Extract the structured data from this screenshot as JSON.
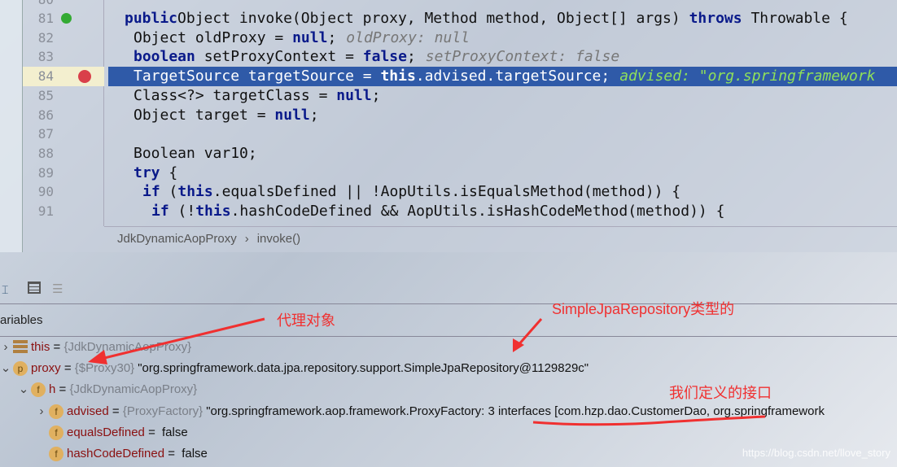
{
  "editor": {
    "lines": [
      {
        "n": "81",
        "indent": 1,
        "parts": [
          [
            "kw",
            "public"
          ],
          [
            "",
            "Object invoke(Object proxy, Method method, Object[] args) "
          ],
          [
            "kw",
            "throws"
          ],
          [
            "",
            " Throwable {"
          ]
        ]
      },
      {
        "n": "82",
        "indent": 2,
        "parts": [
          [
            "",
            "Object oldProxy = "
          ],
          [
            "kw",
            "null"
          ],
          [
            "",
            ";"
          ],
          [
            "hint",
            "oldProxy: null"
          ]
        ]
      },
      {
        "n": "83",
        "indent": 2,
        "parts": [
          [
            "kw",
            "boolean"
          ],
          [
            "",
            " setProxyContext = "
          ],
          [
            "kw",
            "false"
          ],
          [
            "",
            ";"
          ],
          [
            "hint",
            "setProxyContext: false"
          ]
        ]
      },
      {
        "n": "84",
        "indent": 2,
        "current": true,
        "parts": [
          [
            "",
            "TargetSource targetSource = "
          ],
          [
            "kw",
            "this"
          ],
          [
            "",
            ".advised.targetSource;"
          ],
          [
            "hint",
            "advised: \"org.springframework"
          ]
        ]
      },
      {
        "n": "85",
        "indent": 2,
        "parts": [
          [
            "",
            "Class<?> targetClass = "
          ],
          [
            "kw",
            "null"
          ],
          [
            "",
            ";"
          ]
        ]
      },
      {
        "n": "86",
        "indent": 2,
        "parts": [
          [
            "",
            "Object target = "
          ],
          [
            "kw",
            "null"
          ],
          [
            "",
            ";"
          ]
        ]
      },
      {
        "n": "87",
        "indent": 0,
        "parts": []
      },
      {
        "n": "88",
        "indent": 2,
        "parts": [
          [
            "",
            "Boolean var10;"
          ]
        ]
      },
      {
        "n": "89",
        "indent": 2,
        "parts": [
          [
            "kw",
            "try"
          ],
          [
            "",
            " {"
          ]
        ]
      },
      {
        "n": "90",
        "indent": 3,
        "parts": [
          [
            "kw",
            "if"
          ],
          [
            "",
            " ("
          ],
          [
            "kw",
            "this"
          ],
          [
            "",
            ".equalsDefined || !AopUtils.isEqualsMethod(method)) {"
          ]
        ]
      },
      {
        "n": "91",
        "indent": 4,
        "parts": [
          [
            "kw",
            "if"
          ],
          [
            "",
            " (!"
          ],
          [
            "kw",
            "this"
          ],
          [
            "",
            ".hashCodeDefined && AopUtils.isHashCodeMethod(method)) {"
          ]
        ]
      }
    ],
    "breadcrumb": [
      "JdkDynamicAopProxy",
      "invoke()"
    ]
  },
  "variables": {
    "header": "ariables",
    "rows": [
      {
        "icon": "field-list-icon",
        "letter": "",
        "name": "this",
        "type": "{JdkDynamicAopProxy}",
        "value": "",
        "expander": "right",
        "level": 0
      },
      {
        "icon": "parameter-icon",
        "letter": "p",
        "name": "proxy",
        "type": "{$Proxy30}",
        "value": "\"org.springframework.data.jpa.repository.support.SimpleJpaRepository@1129829c\"",
        "expander": "down",
        "level": 0
      },
      {
        "icon": "field-icon",
        "letter": "f",
        "name": "h",
        "type": "{JdkDynamicAopProxy}",
        "value": "",
        "expander": "down",
        "level": 1
      },
      {
        "icon": "field-icon",
        "letter": "f",
        "name": "advised",
        "type": "{ProxyFactory}",
        "value": "\"org.springframework.aop.framework.ProxyFactory: 3 interfaces [com.hzp.dao.CustomerDao, org.springframework",
        "expander": "right",
        "level": 2
      },
      {
        "icon": "field-icon",
        "letter": "f",
        "name": "equalsDefined",
        "type": "",
        "value": "false",
        "expander": "",
        "level": 2
      },
      {
        "icon": "field-icon",
        "letter": "f",
        "name": "hashCodeDefined",
        "type": "",
        "value": "false",
        "expander": "",
        "level": 2
      }
    ]
  },
  "annotations": {
    "proxy_object": "代理对象",
    "simple_jpa": "SimpleJpaRepository类型的",
    "our_interface": "我们定义的接口",
    "color": "#f03030"
  },
  "watermark": "https://blog.csdn.net/llove_story"
}
